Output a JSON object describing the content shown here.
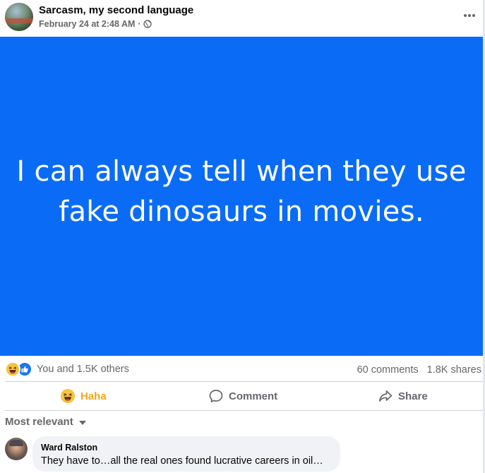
{
  "post": {
    "page_name": "Sarcasm, my second language",
    "timestamp": "February 24 at 2:48 AM",
    "meta_separator": "·",
    "visibility_icon": "globe-icon",
    "more_icon": "more-options-icon",
    "image_text": "I can always tell when they use fake dinosaurs in movies.",
    "image_background": "#0a6cf6"
  },
  "stats": {
    "reactors_text": "You and 1.5K others",
    "comments_text": "60 comments",
    "shares_text": "1.8K shares",
    "reaction_icons": [
      "haha-reaction-icon",
      "like-reaction-icon"
    ]
  },
  "actions": {
    "haha_label": "Haha",
    "comment_label": "Comment",
    "share_label": "Share",
    "haha_color": "#f0a81d"
  },
  "comments": {
    "sort_label": "Most relevant",
    "items": [
      {
        "author": "Ward Ralston",
        "text": "They have to…all the real ones found lucrative careers in oil…"
      }
    ]
  }
}
